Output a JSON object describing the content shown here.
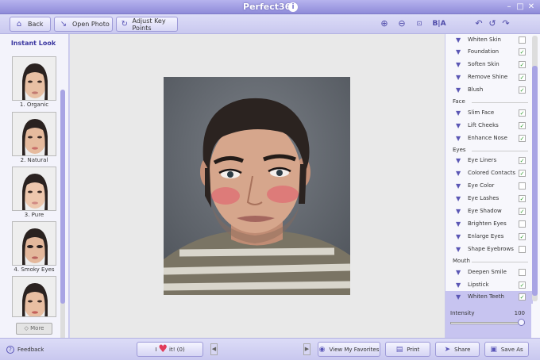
{
  "app": {
    "title": "Perfect365"
  },
  "toolbar": {
    "back_label": "Back",
    "open_photo_label": "Open Photo",
    "adjust_label": "Adjust Key Points",
    "compare_label": "B|A"
  },
  "left": {
    "title": "Instant Look",
    "looks": [
      {
        "label": "1. Organic"
      },
      {
        "label": "2. Natural"
      },
      {
        "label": "3. Pure"
      },
      {
        "label": "4. Smoky Eyes"
      }
    ],
    "more_label": "More"
  },
  "right": {
    "rows": [
      {
        "label": "Whiten Skin",
        "checked": false
      },
      {
        "label": "Foundation",
        "checked": true
      },
      {
        "label": "Soften Skin",
        "checked": true
      },
      {
        "label": "Remove Shine",
        "checked": true
      },
      {
        "label": "Blush",
        "checked": true
      }
    ],
    "face_label": "Face",
    "face_rows": [
      {
        "label": "Slim Face",
        "checked": true
      },
      {
        "label": "Lift Cheeks",
        "checked": true
      },
      {
        "label": "Enhance Nose",
        "checked": true
      }
    ],
    "eyes_label": "Eyes",
    "eyes_rows": [
      {
        "label": "Eye Liners",
        "checked": true
      },
      {
        "label": "Colored Contacts",
        "checked": true
      },
      {
        "label": "Eye Color",
        "checked": false
      },
      {
        "label": "Eye Lashes",
        "checked": true
      },
      {
        "label": "Eye Shadow",
        "checked": true
      },
      {
        "label": "Brighten Eyes",
        "checked": false
      },
      {
        "label": "Enlarge Eyes",
        "checked": true
      },
      {
        "label": "Shape Eyebrows",
        "checked": false
      }
    ],
    "mouth_label": "Mouth",
    "mouth_rows": [
      {
        "label": "Deepen Smile",
        "checked": false
      },
      {
        "label": "Lipstick",
        "checked": true
      },
      {
        "label": "Whiten Teeth",
        "checked": true
      }
    ],
    "intensity_label": "Intensity",
    "intensity_value": "100"
  },
  "bottom": {
    "feedback_label": "Feedback",
    "love_prefix": "I",
    "love_suffix": "it! (0)",
    "favorites_label": "View My Favorites",
    "print_label": "Print",
    "share_label": "Share",
    "save_label": "Save As"
  },
  "colors": {
    "accent": "#8f8bd9",
    "selected": "#c7c4f0",
    "check": "#2a9a2a"
  }
}
